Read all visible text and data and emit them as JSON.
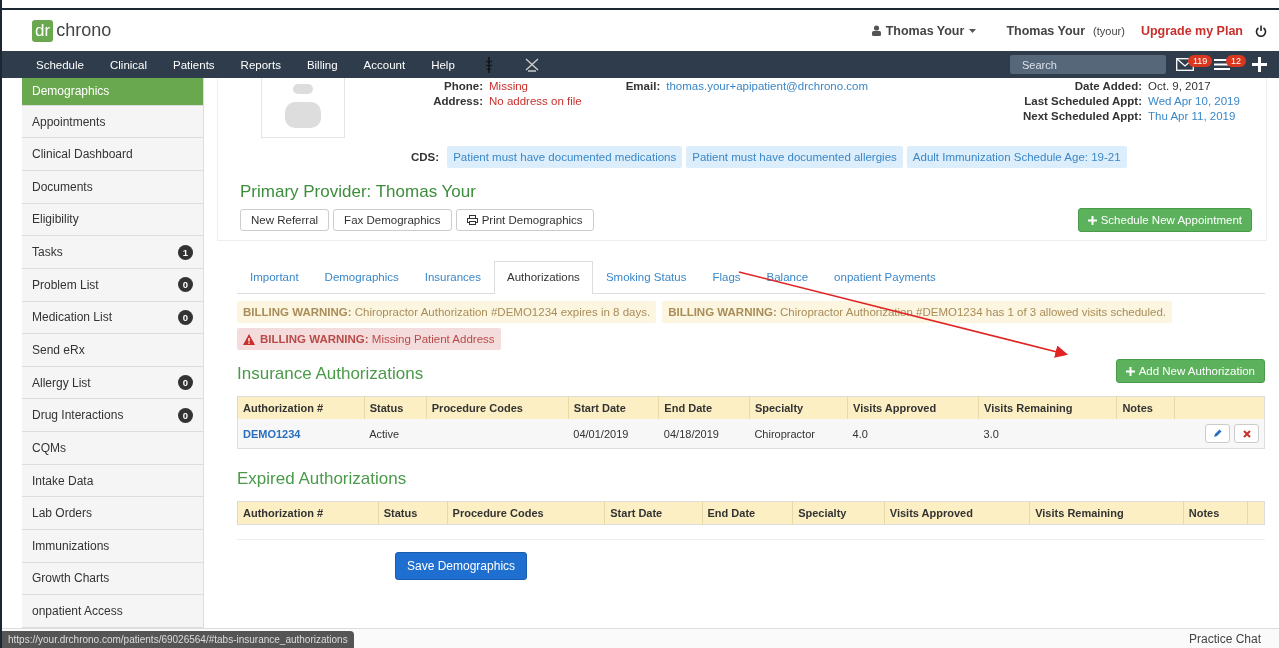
{
  "header": {
    "logo": {
      "mark": "dr",
      "text": "chrono"
    },
    "user_menu": "Thomas Your",
    "account_name": "Thomas Your",
    "account_handle": "(tyour)",
    "upgrade_link": "Upgrade my Plan"
  },
  "navbar": {
    "items": [
      "Schedule",
      "Clinical",
      "Patients",
      "Reports",
      "Billing",
      "Account",
      "Help"
    ],
    "search": {
      "placeholder": "Search"
    },
    "messages_badge": "119",
    "tasks_badge": "12"
  },
  "sidebar": {
    "items": [
      {
        "label": "Demographics",
        "selected": true
      },
      {
        "label": "Appointments",
        "selected": false
      },
      {
        "label": "Clinical Dashboard",
        "selected": false
      },
      {
        "label": "Documents",
        "selected": false
      },
      {
        "label": "Eligibility",
        "selected": false
      },
      {
        "label": "Tasks",
        "selected": false,
        "badge": "1"
      },
      {
        "label": "Problem List",
        "selected": false,
        "badge": "0"
      },
      {
        "label": "Medication List",
        "selected": false,
        "badge": "0"
      },
      {
        "label": "Send eRx",
        "selected": false
      },
      {
        "label": "Allergy List",
        "selected": false,
        "badge": "0"
      },
      {
        "label": "Drug Interactions",
        "selected": false,
        "badge": "0"
      },
      {
        "label": "CQMs",
        "selected": false
      },
      {
        "label": "Intake Data",
        "selected": false
      },
      {
        "label": "Lab Orders",
        "selected": false
      },
      {
        "label": "Immunizations",
        "selected": false
      },
      {
        "label": "Growth Charts",
        "selected": false
      },
      {
        "label": "onpatient Access",
        "selected": false
      }
    ]
  },
  "patient": {
    "left_fields": [
      {
        "label": "Phone:",
        "value": "Missing",
        "kind": "missing"
      },
      {
        "label": "Address:",
        "value": "No address on file",
        "kind": "missing"
      }
    ],
    "email": {
      "label": "Email:",
      "value": "thomas.your+apipatient@drchrono.com"
    },
    "right_fields": [
      {
        "label": "Date Added:",
        "value": "Oct. 9, 2017",
        "kind": "plain"
      },
      {
        "label": "Last Scheduled Appt:",
        "value": "Wed Apr 10, 2019",
        "kind": "link"
      },
      {
        "label": "Next Scheduled Appt:",
        "value": "Thu Apr 11, 2019",
        "kind": "link"
      }
    ],
    "cds": {
      "label": "CDS:",
      "alerts": [
        "Patient must have documented medications",
        "Patient must have documented allergies",
        "Adult Immunization Schedule Age: 19-21"
      ]
    }
  },
  "provider": {
    "title": "Primary Provider: Thomas Your",
    "buttons": [
      {
        "label": "New Referral",
        "kind": "plain"
      },
      {
        "label": "Fax Demographics",
        "kind": "plain"
      },
      {
        "label": "Print Demographics",
        "kind": "print"
      }
    ],
    "schedule_button": "Schedule New Appointment"
  },
  "tabs": [
    {
      "label": "Important",
      "selected": false
    },
    {
      "label": "Demographics",
      "selected": false
    },
    {
      "label": "Insurances",
      "selected": false
    },
    {
      "label": "Authorizations",
      "selected": true
    },
    {
      "label": "Smoking Status",
      "selected": false
    },
    {
      "label": "Flags",
      "selected": false
    },
    {
      "label": "Balance",
      "selected": false
    },
    {
      "label": "onpatient Payments",
      "selected": false
    }
  ],
  "warnings": [
    {
      "kind": "warning",
      "title": "BILLING WARNING:",
      "text": "Chiropractor Authorization #DEMO1234 expires in 8 days."
    },
    {
      "kind": "warning",
      "title": "BILLING WARNING:",
      "text": "Chiropractor Authorization #DEMO1234 has 1 of 3 allowed visits scheduled."
    },
    {
      "kind": "danger",
      "title": "BILLING WARNING:",
      "text": "Missing Patient Address"
    }
  ],
  "insurance_authorizations": {
    "title": "Insurance Authorizations",
    "add_button": "Add New Authorization",
    "columns": [
      "Authorization #",
      "Status",
      "Procedure Codes",
      "Start Date",
      "End Date",
      "Specialty",
      "Visits Approved",
      "Visits Remaining",
      "Notes"
    ],
    "rows": [
      {
        "cells": [
          "DEMO1234",
          "Active",
          "",
          "04/01/2019",
          "04/18/2019",
          "Chiropractor",
          "4.0",
          "3.0",
          ""
        ]
      }
    ]
  },
  "expired_authorizations": {
    "title": "Expired Authorizations",
    "columns": [
      "Authorization #",
      "Status",
      "Procedure Codes",
      "Start Date",
      "End Date",
      "Specialty",
      "Visits Approved",
      "Visits Remaining",
      "Notes"
    ]
  },
  "save_button": "Save Demographics",
  "status_url": "https://your.drchrono.com/patients/69026564/#tabs-insurance_authorizations",
  "footer": {
    "chat": "Practice Chat"
  }
}
